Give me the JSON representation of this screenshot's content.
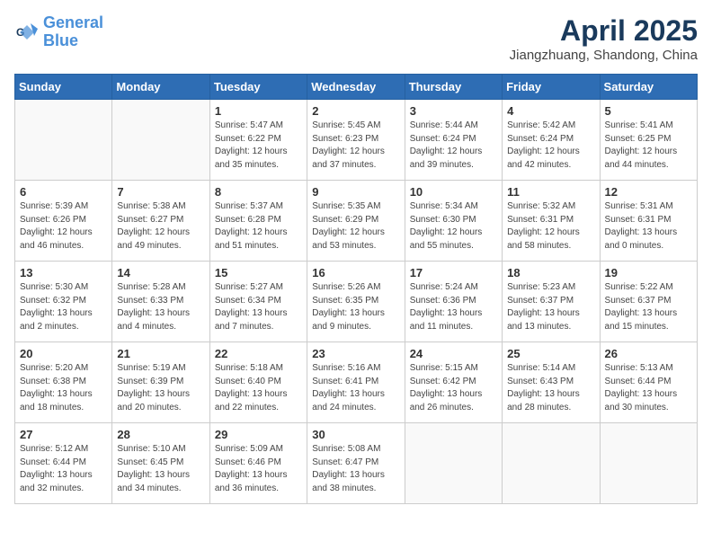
{
  "header": {
    "logo_line1": "General",
    "logo_line2": "Blue",
    "month": "April 2025",
    "location": "Jiangzhuang, Shandong, China"
  },
  "weekdays": [
    "Sunday",
    "Monday",
    "Tuesday",
    "Wednesday",
    "Thursday",
    "Friday",
    "Saturday"
  ],
  "weeks": [
    [
      {
        "day": "",
        "info": ""
      },
      {
        "day": "",
        "info": ""
      },
      {
        "day": "1",
        "info": "Sunrise: 5:47 AM\nSunset: 6:22 PM\nDaylight: 12 hours and 35 minutes."
      },
      {
        "day": "2",
        "info": "Sunrise: 5:45 AM\nSunset: 6:23 PM\nDaylight: 12 hours and 37 minutes."
      },
      {
        "day": "3",
        "info": "Sunrise: 5:44 AM\nSunset: 6:24 PM\nDaylight: 12 hours and 39 minutes."
      },
      {
        "day": "4",
        "info": "Sunrise: 5:42 AM\nSunset: 6:24 PM\nDaylight: 12 hours and 42 minutes."
      },
      {
        "day": "5",
        "info": "Sunrise: 5:41 AM\nSunset: 6:25 PM\nDaylight: 12 hours and 44 minutes."
      }
    ],
    [
      {
        "day": "6",
        "info": "Sunrise: 5:39 AM\nSunset: 6:26 PM\nDaylight: 12 hours and 46 minutes."
      },
      {
        "day": "7",
        "info": "Sunrise: 5:38 AM\nSunset: 6:27 PM\nDaylight: 12 hours and 49 minutes."
      },
      {
        "day": "8",
        "info": "Sunrise: 5:37 AM\nSunset: 6:28 PM\nDaylight: 12 hours and 51 minutes."
      },
      {
        "day": "9",
        "info": "Sunrise: 5:35 AM\nSunset: 6:29 PM\nDaylight: 12 hours and 53 minutes."
      },
      {
        "day": "10",
        "info": "Sunrise: 5:34 AM\nSunset: 6:30 PM\nDaylight: 12 hours and 55 minutes."
      },
      {
        "day": "11",
        "info": "Sunrise: 5:32 AM\nSunset: 6:31 PM\nDaylight: 12 hours and 58 minutes."
      },
      {
        "day": "12",
        "info": "Sunrise: 5:31 AM\nSunset: 6:31 PM\nDaylight: 13 hours and 0 minutes."
      }
    ],
    [
      {
        "day": "13",
        "info": "Sunrise: 5:30 AM\nSunset: 6:32 PM\nDaylight: 13 hours and 2 minutes."
      },
      {
        "day": "14",
        "info": "Sunrise: 5:28 AM\nSunset: 6:33 PM\nDaylight: 13 hours and 4 minutes."
      },
      {
        "day": "15",
        "info": "Sunrise: 5:27 AM\nSunset: 6:34 PM\nDaylight: 13 hours and 7 minutes."
      },
      {
        "day": "16",
        "info": "Sunrise: 5:26 AM\nSunset: 6:35 PM\nDaylight: 13 hours and 9 minutes."
      },
      {
        "day": "17",
        "info": "Sunrise: 5:24 AM\nSunset: 6:36 PM\nDaylight: 13 hours and 11 minutes."
      },
      {
        "day": "18",
        "info": "Sunrise: 5:23 AM\nSunset: 6:37 PM\nDaylight: 13 hours and 13 minutes."
      },
      {
        "day": "19",
        "info": "Sunrise: 5:22 AM\nSunset: 6:37 PM\nDaylight: 13 hours and 15 minutes."
      }
    ],
    [
      {
        "day": "20",
        "info": "Sunrise: 5:20 AM\nSunset: 6:38 PM\nDaylight: 13 hours and 18 minutes."
      },
      {
        "day": "21",
        "info": "Sunrise: 5:19 AM\nSunset: 6:39 PM\nDaylight: 13 hours and 20 minutes."
      },
      {
        "day": "22",
        "info": "Sunrise: 5:18 AM\nSunset: 6:40 PM\nDaylight: 13 hours and 22 minutes."
      },
      {
        "day": "23",
        "info": "Sunrise: 5:16 AM\nSunset: 6:41 PM\nDaylight: 13 hours and 24 minutes."
      },
      {
        "day": "24",
        "info": "Sunrise: 5:15 AM\nSunset: 6:42 PM\nDaylight: 13 hours and 26 minutes."
      },
      {
        "day": "25",
        "info": "Sunrise: 5:14 AM\nSunset: 6:43 PM\nDaylight: 13 hours and 28 minutes."
      },
      {
        "day": "26",
        "info": "Sunrise: 5:13 AM\nSunset: 6:44 PM\nDaylight: 13 hours and 30 minutes."
      }
    ],
    [
      {
        "day": "27",
        "info": "Sunrise: 5:12 AM\nSunset: 6:44 PM\nDaylight: 13 hours and 32 minutes."
      },
      {
        "day": "28",
        "info": "Sunrise: 5:10 AM\nSunset: 6:45 PM\nDaylight: 13 hours and 34 minutes."
      },
      {
        "day": "29",
        "info": "Sunrise: 5:09 AM\nSunset: 6:46 PM\nDaylight: 13 hours and 36 minutes."
      },
      {
        "day": "30",
        "info": "Sunrise: 5:08 AM\nSunset: 6:47 PM\nDaylight: 13 hours and 38 minutes."
      },
      {
        "day": "",
        "info": ""
      },
      {
        "day": "",
        "info": ""
      },
      {
        "day": "",
        "info": ""
      }
    ]
  ]
}
